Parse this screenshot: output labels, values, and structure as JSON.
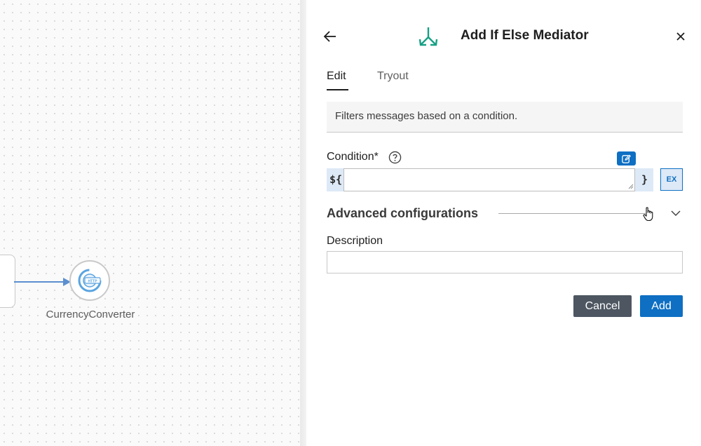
{
  "canvas": {
    "endpoint_label": "CurrencyConverter",
    "endpoint_icon": "http-endpoint-icon",
    "edge_color": "#5b8fd0"
  },
  "panel": {
    "title": "Add If Else Mediator",
    "back_icon": "arrow-left-icon",
    "close_icon": "close-icon",
    "mediator_icon": "if-else-branch-icon",
    "mediator_icon_color": "#17a085",
    "tabs": [
      {
        "label": "Edit",
        "active": true
      },
      {
        "label": "Tryout",
        "active": false
      }
    ],
    "description_text": "Filters messages based on a condition.",
    "condition": {
      "label": "Condition*",
      "prefix": "${",
      "suffix": "}",
      "value": "",
      "expression_toggle": "EX",
      "edit_icon": "edit-expression-icon",
      "help_icon": "help-circle-icon"
    },
    "advanced": {
      "title": "Advanced configurations",
      "chevron_icon": "chevron-down-icon"
    },
    "description_field": {
      "label": "Description",
      "value": ""
    },
    "buttons": {
      "cancel": "Cancel",
      "add": "Add"
    },
    "colors": {
      "accent": "#0e6fc3",
      "cancel_bg": "#4d5661",
      "expr_bg": "#dde9f7"
    }
  }
}
